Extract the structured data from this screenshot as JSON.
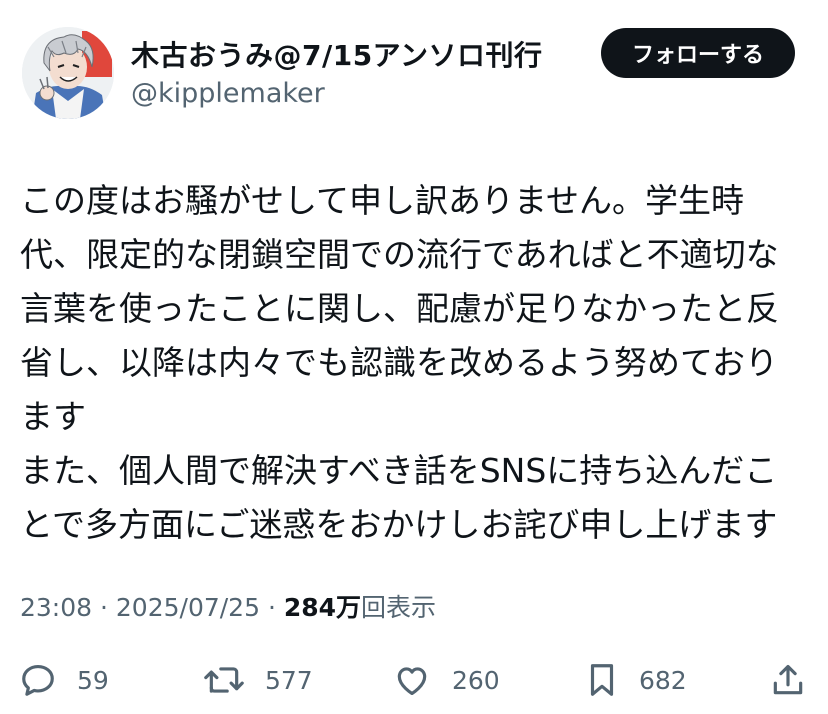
{
  "author": {
    "display_name": "木古おうみ@7/15アンソロ刊行",
    "handle": "@kipplemaker"
  },
  "follow_button": {
    "label": "フォローする"
  },
  "tweet": {
    "lines": [
      "この度はお騒がせして申し訳ありません。学生時",
      "代、限定的な閉鎖空間での流行であればと不適切な",
      "言葉を使ったことに関し、配慮が足りなかったと反",
      "省し、以降は内々でも認識を改めるよう努めており",
      "ます",
      "また、個人間で解決すべき話をSNSに持ち込んだこ",
      "とで多方面にご迷惑をおかけしお詫び申し上げます"
    ]
  },
  "meta": {
    "time": "23:08",
    "separator": "·",
    "date": "2025/07/25",
    "views_count": "284万",
    "views_label": "回表示"
  },
  "actions": {
    "reply": {
      "icon": "reply-icon",
      "count": "59"
    },
    "retweet": {
      "icon": "retweet-icon",
      "count": "577"
    },
    "like": {
      "icon": "heart-icon",
      "count": "260"
    },
    "bookmark": {
      "icon": "bookmark-icon",
      "count": "682"
    },
    "share": {
      "icon": "share-icon"
    }
  },
  "colors": {
    "text_primary": "#0f1419",
    "text_secondary": "#536471",
    "button_bg": "#0f1419",
    "button_text": "#ffffff"
  }
}
